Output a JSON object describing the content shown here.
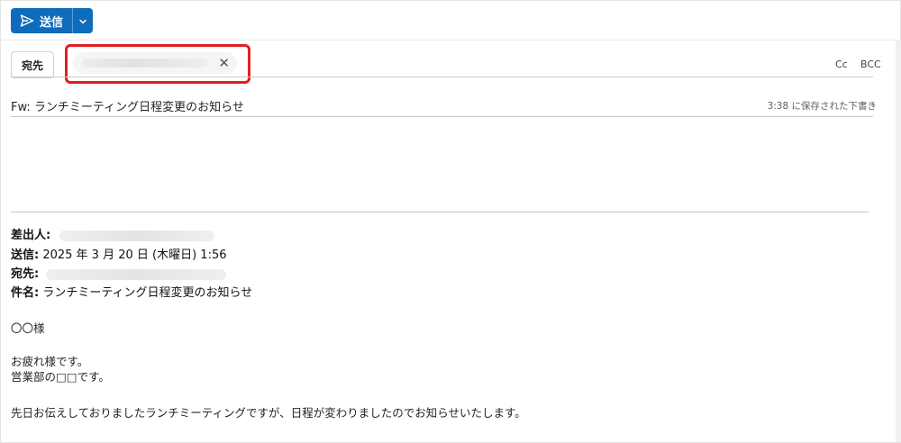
{
  "toolbar": {
    "send_label": "送信",
    "send_icon": "send-icon",
    "dropdown_icon": "chevron-down-icon",
    "accent_color": "#0f6cbd"
  },
  "recipients": {
    "to_label": "宛先",
    "chip_remove_glyph": "✕",
    "cc_label": "Cc",
    "bcc_label": "BCC",
    "highlight_color": "#e02020"
  },
  "subject": {
    "value": "Fw: ランチミーティング日程変更のお知らせ",
    "draft_status": "3:38 に保存された下書き"
  },
  "forward_header": {
    "from_label": "差出人:",
    "sent_label": "送信:",
    "sent_value": " 2025 年 3 月 20 日 (木曜日) 1:56",
    "to_label": "宛先:",
    "subject_label": "件名:",
    "subject_value": " ランチミーティング日程変更のお知らせ"
  },
  "message": {
    "greeting": "〇〇様",
    "line1": "お疲れ様です。",
    "line2": "営業部の□□です。",
    "line3": "先日お伝えしておりましたランチミーティングですが、日程が変わりましたのでお知らせいたします。"
  }
}
